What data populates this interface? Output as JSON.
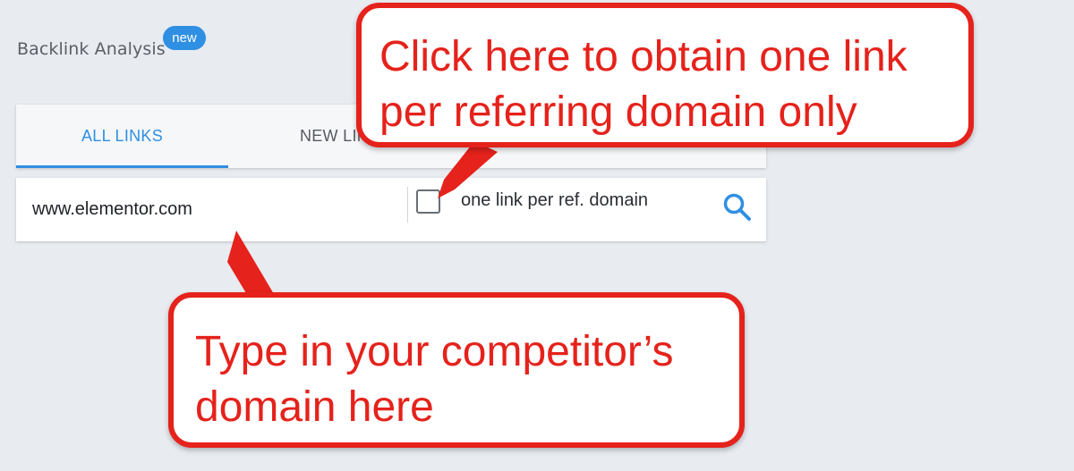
{
  "header": {
    "title": "Backlink Analysis",
    "badge": "new"
  },
  "tabs": [
    {
      "label": "ALL LINKS",
      "active": true
    },
    {
      "label": "NEW LIN",
      "active": false
    }
  ],
  "search": {
    "domain_value": "www.elementor.com",
    "checkbox_label": "one link per ref. domain",
    "checkbox_checked": false,
    "search_icon": "search-icon"
  },
  "annotations": {
    "top_line1": "Click here to obtain one link",
    "top_line2": "per referring domain only",
    "bottom_line1": "Type in your competitor’s",
    "bottom_line2": "domain here"
  },
  "colors": {
    "accent": "#2f8fe3",
    "callout": "#e5221b",
    "background": "#e8ebf0"
  }
}
